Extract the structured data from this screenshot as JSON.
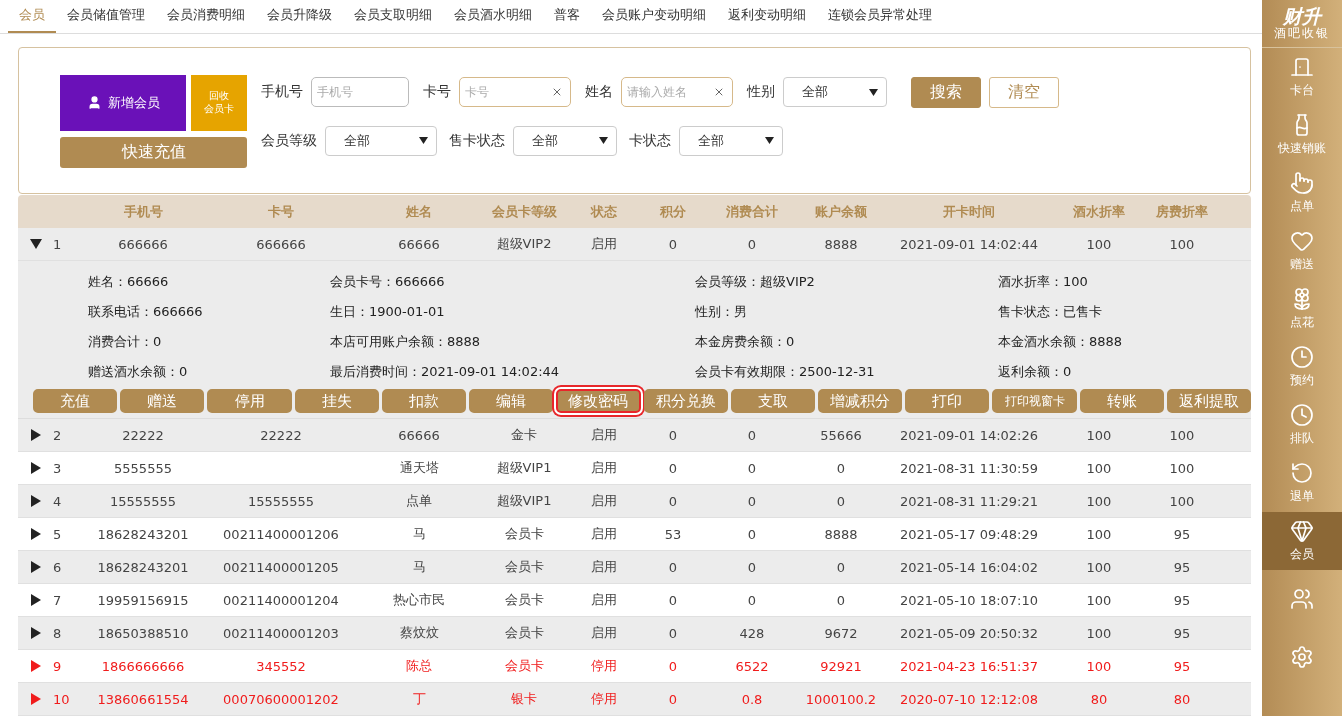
{
  "tabs": [
    {
      "label": "会员",
      "selected": true
    },
    {
      "label": "会员储值管理",
      "selected": false
    },
    {
      "label": "会员消费明细",
      "selected": false
    },
    {
      "label": "会员升降级",
      "selected": false
    },
    {
      "label": "会员支取明细",
      "selected": false
    },
    {
      "label": "会员酒水明细",
      "selected": false
    },
    {
      "label": "普客",
      "selected": false
    },
    {
      "label": "会员账户变动明细",
      "selected": false
    },
    {
      "label": "返利变动明细",
      "selected": false
    },
    {
      "label": "连锁会员异常处理",
      "selected": false
    }
  ],
  "filter": {
    "add_member": "新增会员",
    "recycle_card": [
      "回收",
      "会员卡"
    ],
    "quick_recharge": "快速充值",
    "fields": [
      {
        "label": "手机号",
        "placeholder": "手机号",
        "clearable": false
      },
      {
        "label": "卡号",
        "placeholder": "卡号",
        "clearable": true
      },
      {
        "label": "姓名",
        "placeholder": "请输入姓名",
        "clearable": true
      }
    ],
    "gender": {
      "label": "性别",
      "value": "全部"
    },
    "search": "搜索",
    "clear": "清空",
    "selects": [
      {
        "label": "会员等级",
        "value": "全部"
      },
      {
        "label": "售卡状态",
        "value": "全部"
      },
      {
        "label": "卡状态",
        "value": "全部"
      }
    ]
  },
  "table": {
    "columns": [
      "手机号",
      "卡号",
      "姓名",
      "会员卡等级",
      "状态",
      "积分",
      "消费合计",
      "账户余额",
      "开卡时间",
      "酒水折率",
      "房费折率"
    ],
    "rows": [
      {
        "index": "1",
        "expanded": true,
        "flagged": false,
        "cells": [
          "666666",
          "666666",
          "66666",
          "超级VIP2",
          "启用",
          "0",
          "0",
          "8888",
          "2021-09-01 14:02:44",
          "100",
          "100"
        ],
        "details": [
          [
            "姓名：66666",
            "联系电话：666666",
            "消费合计：0",
            "赠送酒水余额：0"
          ],
          [
            "会员卡号：666666",
            "生日：1900-01-01",
            "本店可用账户余额：8888",
            "最后消费时间：2021-09-01 14:02:44"
          ],
          [
            "会员等级：超级VIP2",
            "性别：男",
            "本金房费余额：0",
            "会员卡有效期限：2500-12-31"
          ],
          [
            "酒水折率：100",
            "售卡状态：已售卡",
            "本金酒水余额：8888",
            "返利余额：0"
          ]
        ],
        "actions": [
          {
            "label": "充值",
            "highlighted": false
          },
          {
            "label": "赠送",
            "highlighted": false
          },
          {
            "label": "停用",
            "highlighted": false
          },
          {
            "label": "挂失",
            "highlighted": false
          },
          {
            "label": "扣款",
            "highlighted": false
          },
          {
            "label": "编辑",
            "highlighted": false
          },
          {
            "label": "修改密码",
            "highlighted": true
          },
          {
            "label": "积分兑换",
            "highlighted": false
          },
          {
            "label": "支取",
            "highlighted": false
          },
          {
            "label": "增减积分",
            "highlighted": false
          },
          {
            "label": "打印",
            "highlighted": false
          },
          {
            "label": "打印视窗卡",
            "highlighted": false
          },
          {
            "label": "转账",
            "highlighted": false
          },
          {
            "label": "返利提取",
            "highlighted": false
          }
        ]
      },
      {
        "index": "2",
        "expanded": false,
        "flagged": false,
        "cells": [
          "22222",
          "22222",
          "66666",
          "金卡",
          "启用",
          "0",
          "0",
          "55666",
          "2021-09-01 14:02:26",
          "100",
          "100"
        ]
      },
      {
        "index": "3",
        "expanded": false,
        "flagged": false,
        "cells": [
          "5555555",
          "",
          "通天塔",
          "超级VIP1",
          "启用",
          "0",
          "0",
          "0",
          "2021-08-31 11:30:59",
          "100",
          "100"
        ]
      },
      {
        "index": "4",
        "expanded": false,
        "flagged": false,
        "cells": [
          "15555555",
          "15555555",
          "点单",
          "超级VIP1",
          "启用",
          "0",
          "0",
          "0",
          "2021-08-31 11:29:21",
          "100",
          "100"
        ]
      },
      {
        "index": "5",
        "expanded": false,
        "flagged": false,
        "cells": [
          "18628243201",
          "00211400001206",
          "马",
          "会员卡",
          "启用",
          "53",
          "0",
          "8888",
          "2021-05-17 09:48:29",
          "100",
          "95"
        ]
      },
      {
        "index": "6",
        "expanded": false,
        "flagged": false,
        "cells": [
          "18628243201",
          "00211400001205",
          "马",
          "会员卡",
          "启用",
          "0",
          "0",
          "0",
          "2021-05-14 16:04:02",
          "100",
          "95"
        ]
      },
      {
        "index": "7",
        "expanded": false,
        "flagged": false,
        "cells": [
          "19959156915",
          "00211400001204",
          "热心市民",
          "会员卡",
          "启用",
          "0",
          "0",
          "0",
          "2021-05-10 18:07:10",
          "100",
          "95"
        ]
      },
      {
        "index": "8",
        "expanded": false,
        "flagged": false,
        "cells": [
          "18650388510",
          "00211400001203",
          "蔡炆炆",
          "会员卡",
          "启用",
          "0",
          "428",
          "9672",
          "2021-05-09 20:50:32",
          "100",
          "95"
        ]
      },
      {
        "index": "9",
        "expanded": false,
        "flagged": true,
        "cells": [
          "1866666666",
          "345552",
          "陈总",
          "会员卡",
          "停用",
          "0",
          "6522",
          "92921",
          "2021-04-23 16:51:37",
          "100",
          "95"
        ]
      },
      {
        "index": "10",
        "expanded": false,
        "flagged": true,
        "cells": [
          "13860661554",
          "00070600001202",
          "丁",
          "银卡",
          "停用",
          "0",
          "0.8",
          "1000100.2",
          "2020-07-10 12:12:08",
          "80",
          "80"
        ]
      }
    ]
  },
  "sidebar": {
    "logo": "财升",
    "subtitle": "酒吧收银",
    "items": [
      {
        "label": "卡台",
        "selected": false
      },
      {
        "label": "快速销账",
        "selected": false
      },
      {
        "label": "点单",
        "selected": false
      },
      {
        "label": "赠送",
        "selected": false
      },
      {
        "label": "点花",
        "selected": false
      },
      {
        "label": "预约",
        "selected": false
      },
      {
        "label": "排队",
        "selected": false
      },
      {
        "label": "退单",
        "selected": false
      },
      {
        "label": "会员",
        "selected": true
      },
      {
        "selected": false
      },
      {
        "selected": false
      }
    ]
  }
}
